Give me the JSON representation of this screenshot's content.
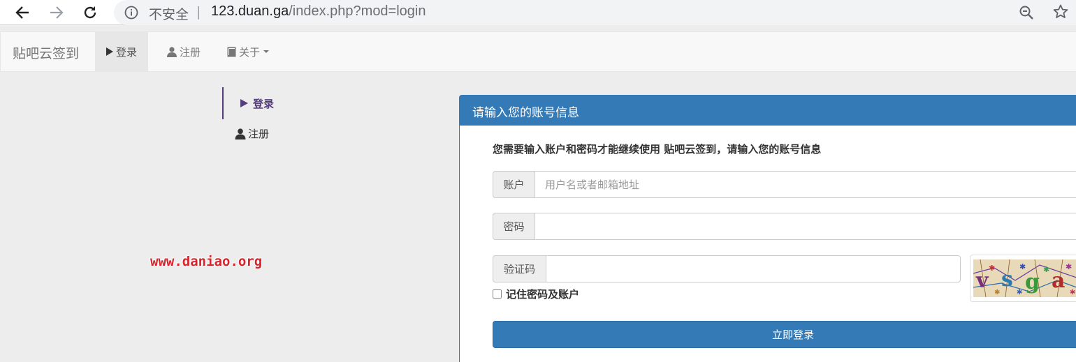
{
  "browser": {
    "insecure_label": "不安全",
    "separator": "|",
    "url_host": "123.duan.ga",
    "url_path": "/index.php?mod=login"
  },
  "navbar": {
    "brand": "贴吧云签到",
    "items": [
      {
        "label": "登录",
        "icon": "play-icon"
      },
      {
        "label": "注册",
        "icon": "user-icon"
      },
      {
        "label": "关于",
        "icon": "book-icon"
      }
    ]
  },
  "sidenav": {
    "items": [
      {
        "label": "登录",
        "icon": "play-icon"
      },
      {
        "label": "注册",
        "icon": "user-icon"
      }
    ]
  },
  "watermark": "www.daniao.org",
  "panel": {
    "title": "请输入您的账号信息",
    "description": "您需要输入账户和密码才能继续使用 贴吧云签到，请输入您的账号信息",
    "account_label": "账户",
    "account_placeholder": "用户名或者邮箱地址",
    "account_value": "",
    "password_label": "密码",
    "password_value": "",
    "captcha_label": "验证码",
    "captcha_value": "",
    "captcha_text": "vsga",
    "remember_label": "记住密码及账户",
    "remember_checked": false,
    "submit_label": "立即登录"
  },
  "colors": {
    "primary": "#337ab7",
    "side_active": "#563d7c",
    "watermark": "#d9232c",
    "page_bg": "#ededed"
  }
}
